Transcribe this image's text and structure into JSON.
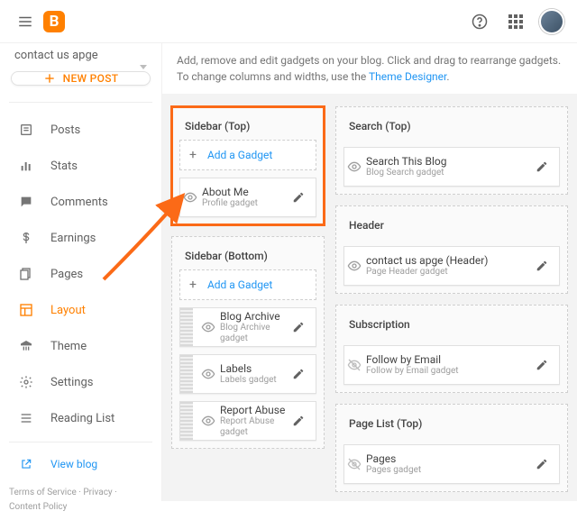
{
  "topbar": {
    "logo_letter": "B"
  },
  "sidebar": {
    "blog_name": "contact us apge",
    "newpost": "NEW POST",
    "items": [
      {
        "icon": "posts",
        "label": "Posts"
      },
      {
        "icon": "stats",
        "label": "Stats"
      },
      {
        "icon": "comments",
        "label": "Comments"
      },
      {
        "icon": "earnings",
        "label": "Earnings"
      },
      {
        "icon": "pages",
        "label": "Pages"
      },
      {
        "icon": "layout",
        "label": "Layout"
      },
      {
        "icon": "theme",
        "label": "Theme"
      },
      {
        "icon": "settings",
        "label": "Settings"
      },
      {
        "icon": "readinglist",
        "label": "Reading List"
      }
    ],
    "viewblog": "View blog",
    "legal": {
      "tos": "Terms of Service",
      "privacy": "Privacy",
      "content": "Content Policy"
    }
  },
  "helper": {
    "text_a": "Add, remove and edit gadgets on your blog. Click and drag to rearrange gadgets. To change columns and widths, use the ",
    "link": "Theme Designer",
    "text_b": "."
  },
  "layout": {
    "add_gadget": "Add a Gadget",
    "col1": [
      {
        "title": "Sidebar (Top)",
        "highlight": true,
        "add": true,
        "gadgets": [
          {
            "title": "About Me",
            "subtitle": "Profile gadget",
            "grip": false,
            "visible": true
          }
        ]
      },
      {
        "title": "Sidebar (Bottom)",
        "add": true,
        "gadgets": [
          {
            "title": "Blog Archive",
            "subtitle": "Blog Archive gadget",
            "grip": true,
            "visible": true
          },
          {
            "title": "Labels",
            "subtitle": "Labels gadget",
            "grip": true,
            "visible": true
          },
          {
            "title": "Report Abuse",
            "subtitle": "Report Abuse gadget",
            "grip": true,
            "visible": true
          }
        ]
      }
    ],
    "col2": [
      {
        "title": "Search (Top)",
        "gadgets": [
          {
            "title": "Search This Blog",
            "subtitle": "Blog Search gadget",
            "visible": true
          }
        ]
      },
      {
        "title": "Header",
        "gadgets": [
          {
            "title": "contact us apge (Header)",
            "subtitle": "Page Header gadget",
            "visible": true
          }
        ]
      },
      {
        "title": "Subscription",
        "gadgets": [
          {
            "title": "Follow by Email",
            "subtitle": "Follow by Email gadget",
            "visible": false
          }
        ]
      },
      {
        "title": "Page List (Top)",
        "gadgets": [
          {
            "title": "Pages",
            "subtitle": "Pages gadget",
            "visible": false
          }
        ]
      }
    ]
  }
}
